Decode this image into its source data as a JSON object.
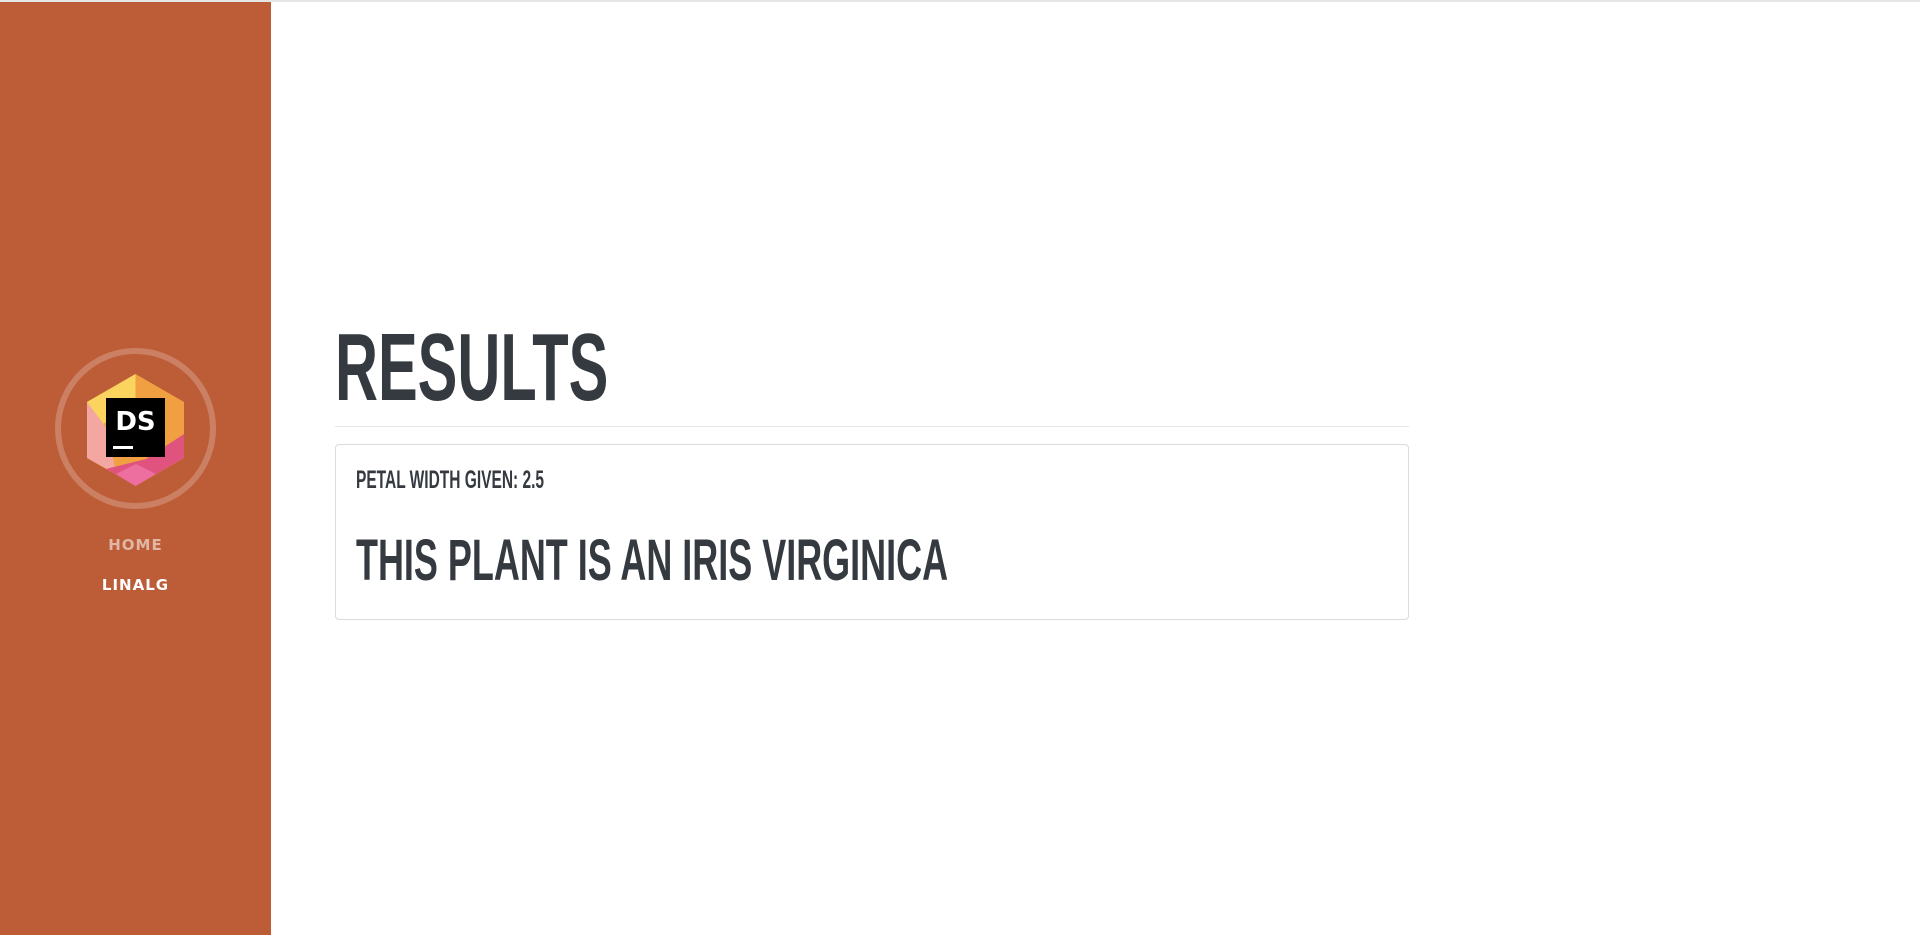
{
  "colors": {
    "sidebar_bg": "#bd5d38",
    "heading": "#343a40"
  },
  "sidebar": {
    "logo_text": "DS",
    "logo_icon": "datascience-logo-icon",
    "nav": [
      {
        "label": "HOME",
        "active": false
      },
      {
        "label": "LINALG",
        "active": true
      }
    ]
  },
  "main": {
    "title": "RESULTS",
    "card": {
      "given": "PETAL WIDTH GIVEN: 2.5",
      "result": "THIS PLANT IS AN IRIS VIRGINICA"
    }
  }
}
